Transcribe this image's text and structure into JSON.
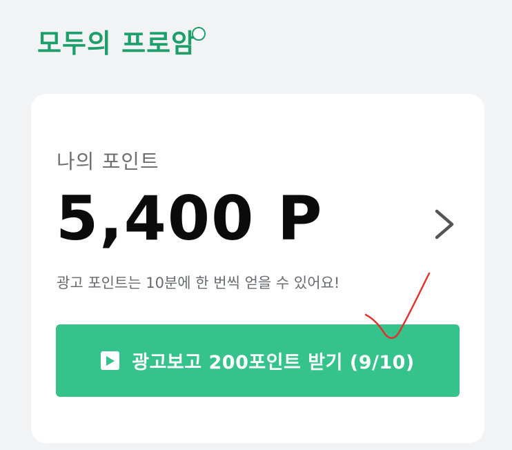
{
  "header": {
    "logo_text": "모두의 프로암"
  },
  "points": {
    "label": "나의 포인트",
    "value": "5,400 P",
    "notice": "광고 포인트는 10분에 한 번씩 얻을 수 있어요!"
  },
  "ad_button": {
    "label": "광고보고 200포인트 받기 (9/10)"
  },
  "icons": {
    "play": "play-icon",
    "chevron": "chevron-right-icon",
    "check": "check-mark-annotation"
  },
  "colors": {
    "brand": "#1e9e6a",
    "button": "#35c28b",
    "check_mark": "#e0312d"
  }
}
